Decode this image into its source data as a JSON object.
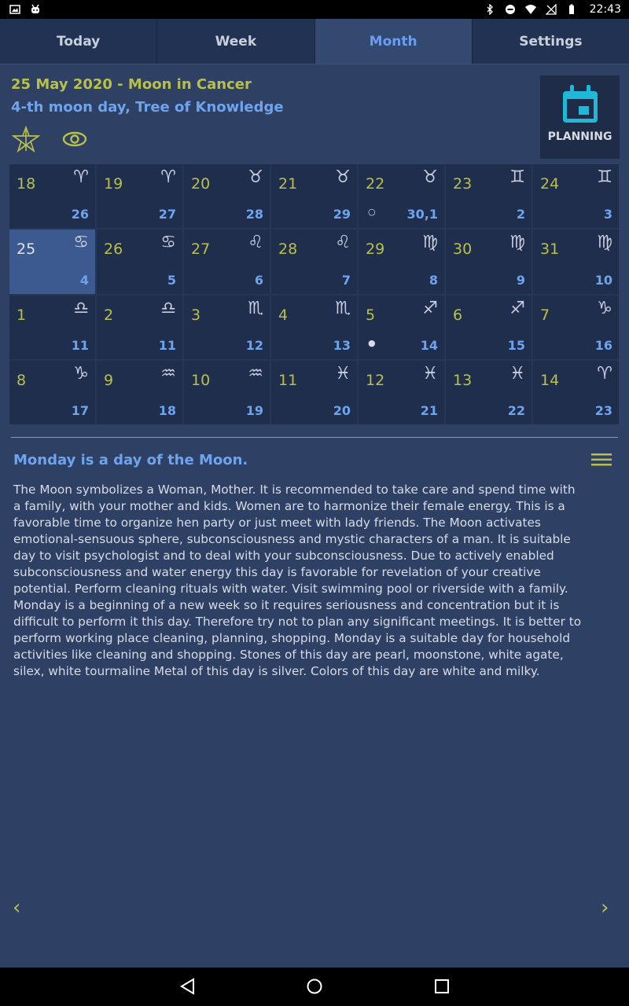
{
  "status_bar": {
    "time": "22:43",
    "left_icons": [
      "image-icon",
      "android-icon"
    ],
    "right_icons": [
      "bluetooth-icon",
      "do-not-disturb-icon",
      "wifi-icon",
      "no-signal-icon",
      "battery-icon"
    ]
  },
  "tabs": [
    {
      "label": "Today",
      "active": false
    },
    {
      "label": "Week",
      "active": false
    },
    {
      "label": "Month",
      "active": true
    },
    {
      "label": "Settings",
      "active": false
    }
  ],
  "header": {
    "date_line": "25 May 2020 - Moon in Cancer",
    "moon_day_line": "4-th moon day, Tree of Knowledge",
    "icons": [
      "star-icon",
      "eye-icon"
    ]
  },
  "planning": {
    "label": "PLANNING",
    "icon": "calendar-icon"
  },
  "calendar": {
    "selected_day": "25",
    "rows": [
      [
        {
          "day": "18",
          "sign": "♈",
          "lunar": "26",
          "phase": ""
        },
        {
          "day": "19",
          "sign": "♈",
          "lunar": "27",
          "phase": ""
        },
        {
          "day": "20",
          "sign": "♉",
          "lunar": "28",
          "phase": ""
        },
        {
          "day": "21",
          "sign": "♉",
          "lunar": "29",
          "phase": ""
        },
        {
          "day": "22",
          "sign": "♉",
          "lunar": "30,1",
          "phase": "○"
        },
        {
          "day": "23",
          "sign": "♊",
          "lunar": "2",
          "phase": ""
        },
        {
          "day": "24",
          "sign": "♊",
          "lunar": "3",
          "phase": ""
        }
      ],
      [
        {
          "day": "25",
          "sign": "♋",
          "lunar": "4",
          "phase": ""
        },
        {
          "day": "26",
          "sign": "♋",
          "lunar": "5",
          "phase": ""
        },
        {
          "day": "27",
          "sign": "♌",
          "lunar": "6",
          "phase": ""
        },
        {
          "day": "28",
          "sign": "♌",
          "lunar": "7",
          "phase": ""
        },
        {
          "day": "29",
          "sign": "♍",
          "lunar": "8",
          "phase": ""
        },
        {
          "day": "30",
          "sign": "♍",
          "lunar": "9",
          "phase": ""
        },
        {
          "day": "31",
          "sign": "♍",
          "lunar": "10",
          "phase": ""
        }
      ],
      [
        {
          "day": "1",
          "sign": "♎",
          "lunar": "11",
          "phase": ""
        },
        {
          "day": "2",
          "sign": "♎",
          "lunar": "11",
          "phase": ""
        },
        {
          "day": "3",
          "sign": "♏",
          "lunar": "12",
          "phase": ""
        },
        {
          "day": "4",
          "sign": "♏",
          "lunar": "13",
          "phase": ""
        },
        {
          "day": "5",
          "sign": "♐",
          "lunar": "14",
          "phase": "●"
        },
        {
          "day": "6",
          "sign": "♐",
          "lunar": "15",
          "phase": ""
        },
        {
          "day": "7",
          "sign": "♑",
          "lunar": "16",
          "phase": ""
        }
      ],
      [
        {
          "day": "8",
          "sign": "♑",
          "lunar": "17",
          "phase": ""
        },
        {
          "day": "9",
          "sign": "♒",
          "lunar": "18",
          "phase": ""
        },
        {
          "day": "10",
          "sign": "♒",
          "lunar": "19",
          "phase": ""
        },
        {
          "day": "11",
          "sign": "♓",
          "lunar": "20",
          "phase": ""
        },
        {
          "day": "12",
          "sign": "♓",
          "lunar": "21",
          "phase": ""
        },
        {
          "day": "13",
          "sign": "♓",
          "lunar": "22",
          "phase": ""
        },
        {
          "day": "14",
          "sign": "♈",
          "lunar": "23",
          "phase": ""
        }
      ]
    ]
  },
  "description": {
    "title": "Monday is a day of the Moon.",
    "text": "The Moon symbolizes a Woman, Mother. It is recommended to take care and spend time with a family, with your mother and kids. Women are to harmonize their female energy. This is a favorable time to organize hen party or just meet with lady friends. The Moon activates emotional-sensuous sphere, subconsciousness and mystic characters of a man. It is suitable day to visit psychologist and to deal with your subconsciousness. Due to actively enabled subconsciousness and water energy this day is favorable for revelation of your creative potential. Perform cleaning rituals with water. Visit swimming pool or riverside with a family. Monday is a beginning of a new week so it requires seriousness and concentration but it is difficult to perform it this day. Therefore try not to plan any significant meetings. It is better to perform working place cleaning, planning, shopping. Monday is a suitable day for household activities like cleaning and shopping. Stones of this day are pearl, moonstone, white agate, silex, white tourmaline Metal of this day is silver. Colors of this day are white and milky."
  },
  "nav": {
    "prev": "‹",
    "next": "›"
  },
  "colors": {
    "background": "#2e4164",
    "accent_yellow": "#b8c04a",
    "accent_blue": "#6ea4ee",
    "planning_icon": "#1fb8d8",
    "selected_cell": "#3c5a90"
  }
}
